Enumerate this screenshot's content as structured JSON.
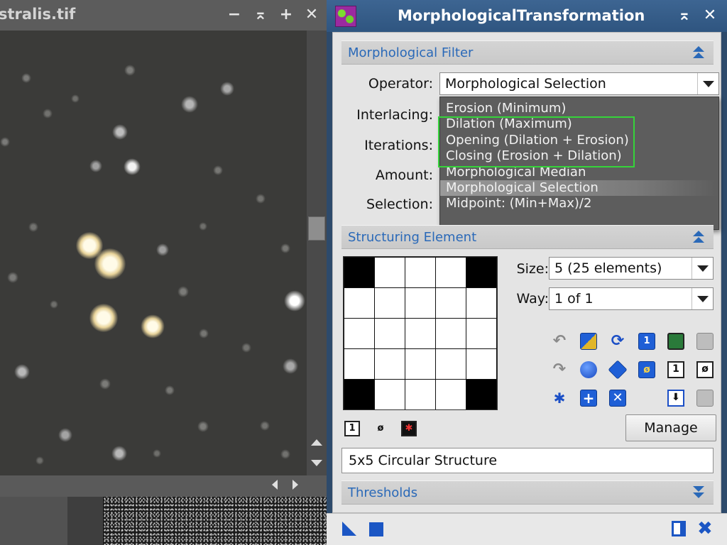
{
  "image_window": {
    "title": "stralis.tif",
    "controls": {
      "minimize": "−",
      "shade": "⌅",
      "maximize": "+",
      "close": "✕"
    }
  },
  "dialog": {
    "title": "MorphologicalTransformation",
    "controls": {
      "shade": "⌅",
      "close": "✕"
    },
    "filter_section": {
      "title": "Morphological Filter",
      "labels": {
        "operator": "Operator:",
        "interlacing": "Interlacing:",
        "iterations": "Iterations:",
        "amount": "Amount:",
        "selection": "Selection:"
      },
      "operator_value": "Morphological Selection",
      "operator_options": [
        "Erosion (Minimum)",
        "Dilation (Maximum)",
        "Opening (Dilation + Erosion)",
        "Closing (Erosion + Dilation)",
        "Morphological Median",
        "Morphological Selection",
        "Midpoint: (Min+Max)/2"
      ],
      "selected_index": 5,
      "highlight_color": "#35d43a"
    },
    "structure_section": {
      "title": "Structuring Element",
      "size_label": "Size:",
      "size_value": "5  (25 elements)",
      "way_label": "Way:",
      "way_value": "1 of 1",
      "grid_rows": [
        [
          0,
          1,
          1,
          1,
          0
        ],
        [
          1,
          1,
          1,
          1,
          1
        ],
        [
          1,
          1,
          1,
          1,
          1
        ],
        [
          1,
          1,
          1,
          1,
          1
        ],
        [
          0,
          1,
          1,
          1,
          0
        ]
      ],
      "small_tools": [
        "1",
        "ø",
        "✱"
      ],
      "manage_label": "Manage",
      "structure_name": "5x5 Circular Structure"
    },
    "thresholds_section": {
      "title": "Thresholds"
    }
  },
  "colors": {
    "accent_blue": "#2a69b8",
    "titlebar_blue": "#2f5580",
    "dropdown_bg": "#5d5d5d"
  }
}
